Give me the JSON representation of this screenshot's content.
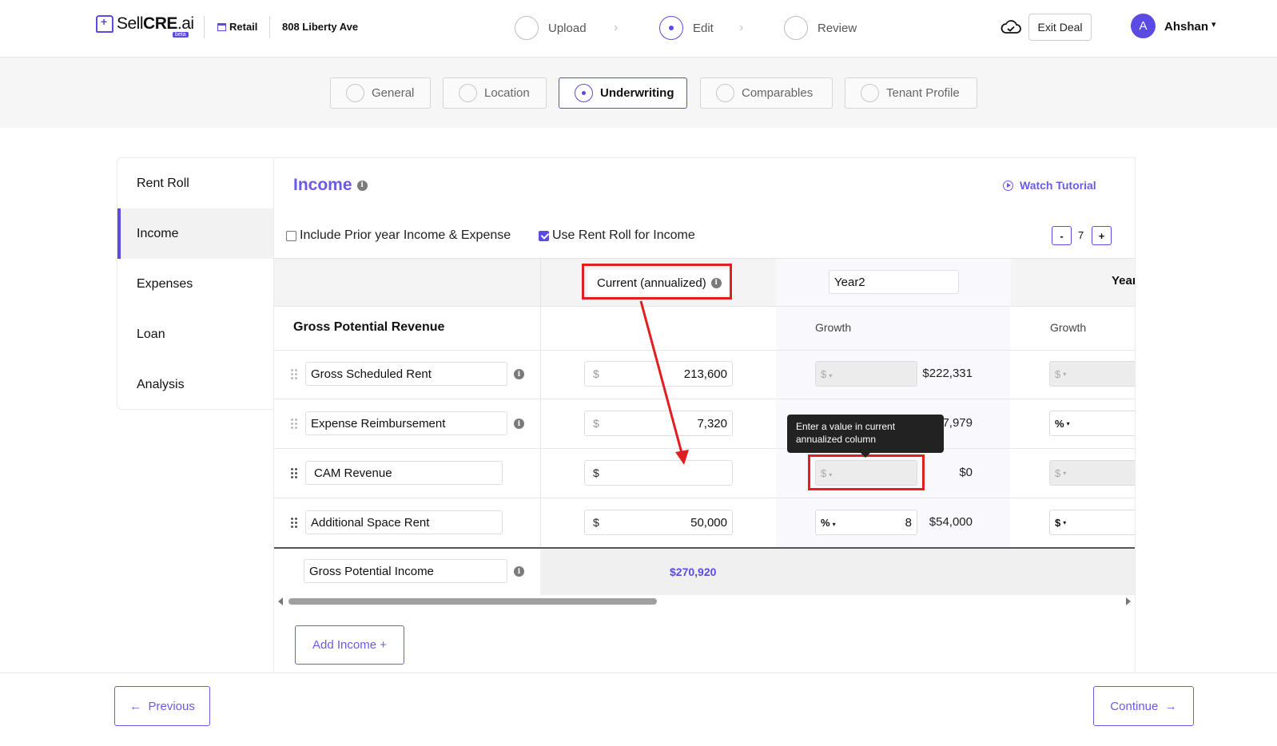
{
  "header": {
    "brand_prefix": "Sell",
    "brand_bold": "CRE",
    "brand_suffix": ".ai",
    "brand_badge": "beta",
    "property_type": "Retail",
    "address": "808 Liberty Ave",
    "steps": [
      {
        "label": "Upload",
        "active": false
      },
      {
        "label": "Edit",
        "active": true
      },
      {
        "label": "Review",
        "active": false
      }
    ],
    "exit_label": "Exit Deal",
    "avatar_initial": "A",
    "user_name": "Ahshan"
  },
  "subtabs": [
    {
      "label": "General",
      "active": false
    },
    {
      "label": "Location",
      "active": false
    },
    {
      "label": "Underwriting",
      "active": true
    },
    {
      "label": "Comparables",
      "active": false
    },
    {
      "label": "Tenant Profile",
      "active": false
    }
  ],
  "sidebar": {
    "items": [
      {
        "label": "Rent Roll",
        "active": false
      },
      {
        "label": "Income",
        "active": true
      },
      {
        "label": "Expenses",
        "active": false
      },
      {
        "label": "Loan",
        "active": false
      },
      {
        "label": "Analysis",
        "active": false
      }
    ]
  },
  "panel": {
    "title": "Income",
    "watch_tutorial": "Watch Tutorial",
    "include_prior_label": "Include Prior year Income & Expense",
    "include_prior_checked": false,
    "use_rent_roll_label": "Use Rent Roll for Income",
    "use_rent_roll_checked": true,
    "years_minus": "-",
    "years_value": "7",
    "years_plus": "+"
  },
  "table": {
    "current_header": "Current (annualized)",
    "year2_header": "Year2",
    "year3_header_partial": "Year",
    "section_label": "Gross Potential Revenue",
    "growth_label": "Growth",
    "rows": [
      {
        "name": "Gross Scheduled Rent",
        "currency": "$",
        "amount": "213,600",
        "growth_unit": "$",
        "growth_value": "",
        "projected": "$222,331",
        "next_unit": "$"
      },
      {
        "name": "Expense Reimbursement",
        "currency": "$",
        "amount": "7,320",
        "growth_unit": "",
        "growth_value": "",
        "projected": "$7,979",
        "next_unit": "%"
      },
      {
        "name": "CAM Revenue",
        "currency": "$",
        "amount": "",
        "growth_unit": "$",
        "growth_value": "",
        "projected": "$0",
        "next_unit": "$"
      },
      {
        "name": "Additional Space Rent",
        "currency": "$",
        "amount": "50,000",
        "growth_unit": "%",
        "growth_value": "8",
        "projected": "$54,000",
        "next_unit": "$"
      }
    ],
    "total_label": "Gross Potential Income",
    "total_value": "$270,920"
  },
  "tooltip": {
    "text": "Enter a value in current annualized column"
  },
  "buttons": {
    "add_income": "Add Income +",
    "previous": "Previous",
    "continue": "Continue"
  },
  "colors": {
    "accent": "#5b4be3",
    "annotation_red": "#e11e22"
  }
}
